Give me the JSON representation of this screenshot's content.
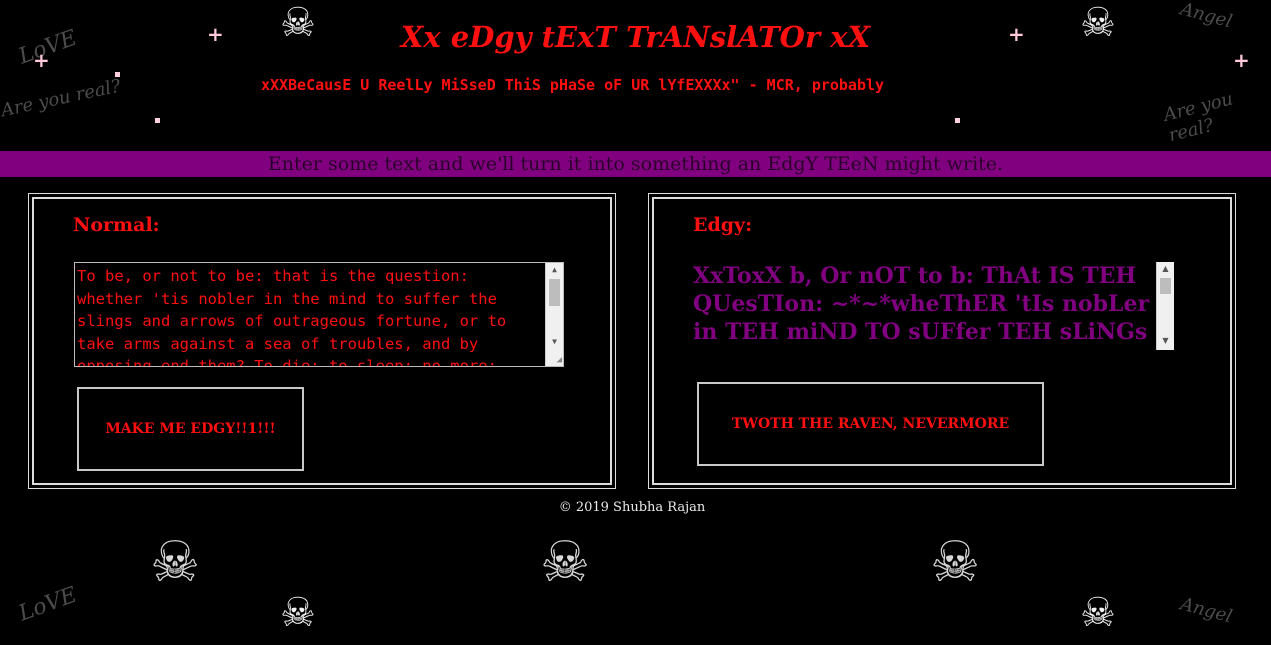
{
  "page": {
    "title": "Xx eDgy tExT TrANslATOr xX",
    "subtitle": "xXXBeCausE U ReelLy MiSseD ThiS pHaSe oF UR lYfEXXXx\" - MCR, probably",
    "banner": "Enter some text and we'll turn it into something an EdgY TEeN might write."
  },
  "background": {
    "doodle_text": [
      "LoVE",
      "Are you real?",
      "Angel",
      "Are you real?",
      "LoVE",
      "Angel"
    ]
  },
  "normal_panel": {
    "label": "Normal:",
    "input_value": "To be, or not to be: that is the question: whether 'tis nobler in the mind to suffer the slings and arrows of outrageous fortune, or to take arms against a sea of troubles, and by opposing end them? To die: to sleep; no more;",
    "button_label": "MAKE ME EDGY!!1!!!"
  },
  "edgy_panel": {
    "label": "Edgy:",
    "output_value": "XxToxX b, Or nOT to b: ThAt IS TEH QUesTIon: ~*~*wheThER 'tIs nobLer in TEH miND TO sUFfer TEH sLiNGs aNd ARrOWs",
    "button_label": "TWOTH THE RAVEN, NEVERMORE"
  },
  "footer": {
    "copyright": "© 2019 Shubha Rajan"
  },
  "colors": {
    "accent_red": "#ff1010",
    "banner_purple": "#800080",
    "background": "#000000"
  }
}
